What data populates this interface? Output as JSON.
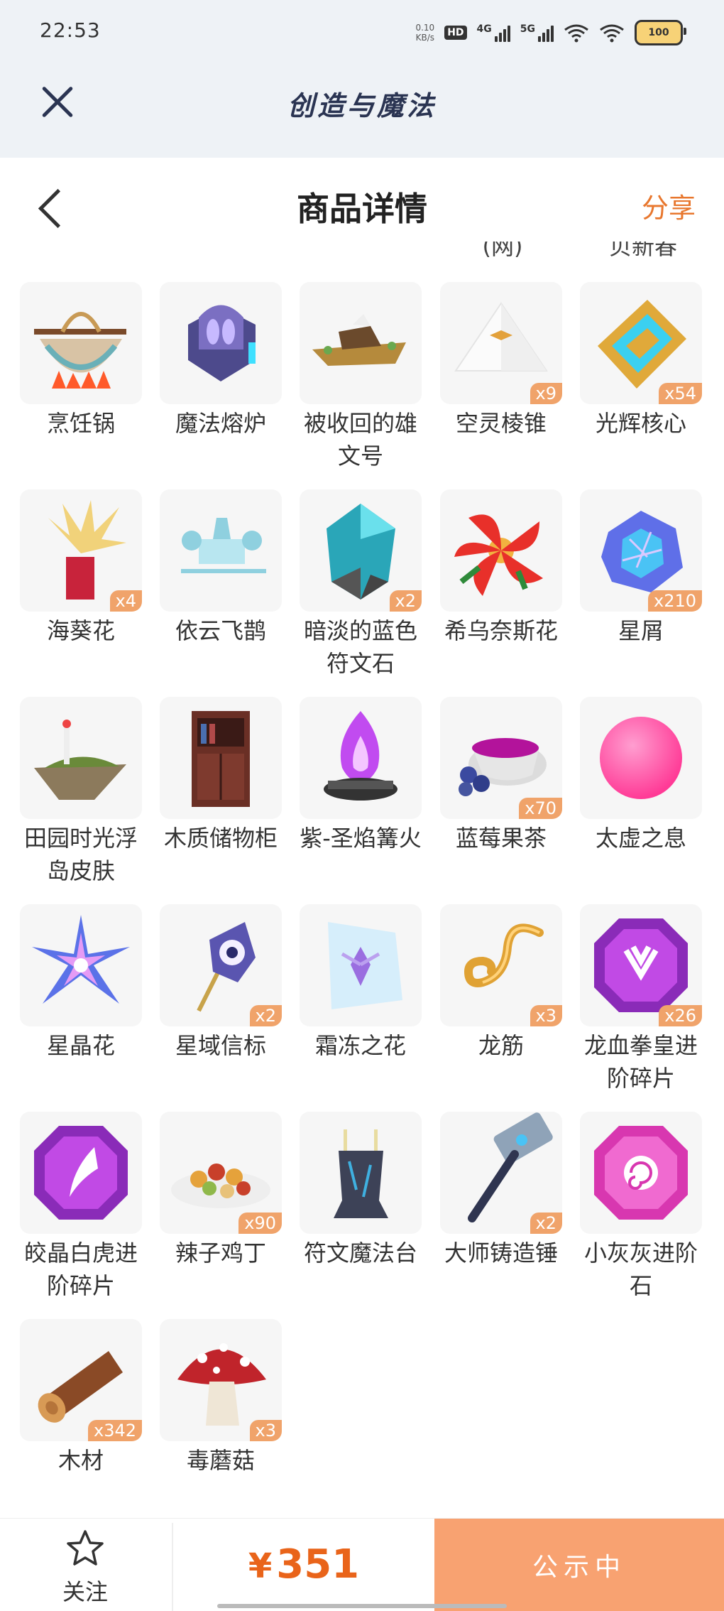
{
  "status_bar": {
    "time": "22:53",
    "net_speed": "0.10",
    "net_unit": "KB/s",
    "hd": "HD",
    "sig1": "4G",
    "sig2": "5G",
    "battery": "100"
  },
  "app": {
    "title": "创造与魔法"
  },
  "header": {
    "title": "商品详情",
    "share": "分享"
  },
  "cut_off_labels": [
    "(网)",
    "贝新春"
  ],
  "items": [
    {
      "name": "烹饪锅",
      "count": "",
      "icon": "cooking-pot-icon"
    },
    {
      "name": "魔法熔炉",
      "count": "",
      "icon": "magic-furnace-icon"
    },
    {
      "name": "被收回的雄文号",
      "count": "",
      "icon": "ship-icon"
    },
    {
      "name": "空灵棱锥",
      "count": "x9",
      "icon": "pyramid-icon"
    },
    {
      "name": "光辉核心",
      "count": "x54",
      "icon": "radiant-core-icon"
    },
    {
      "name": "海葵花",
      "count": "x4",
      "icon": "anemone-flower-icon"
    },
    {
      "name": "依云飞鹊",
      "count": "",
      "icon": "flying-mount-icon"
    },
    {
      "name": "暗淡的蓝色符文石",
      "count": "x2",
      "icon": "blue-rune-stone-icon"
    },
    {
      "name": "希乌奈斯花",
      "count": "",
      "icon": "red-flower-icon"
    },
    {
      "name": "星屑",
      "count": "x210",
      "icon": "stardust-icon"
    },
    {
      "name": "田园时光浮岛皮肤",
      "count": "",
      "icon": "floating-island-icon"
    },
    {
      "name": "木质储物柜",
      "count": "",
      "icon": "wooden-cabinet-icon"
    },
    {
      "name": "紫-圣焰篝火",
      "count": "",
      "icon": "purple-bonfire-icon"
    },
    {
      "name": "蓝莓果茶",
      "count": "x70",
      "icon": "blueberry-tea-icon"
    },
    {
      "name": "太虚之息",
      "count": "",
      "icon": "pink-orb-icon"
    },
    {
      "name": "星晶花",
      "count": "",
      "icon": "star-crystal-flower-icon"
    },
    {
      "name": "星域信标",
      "count": "x2",
      "icon": "star-beacon-icon"
    },
    {
      "name": "霜冻之花",
      "count": "",
      "icon": "frost-flower-icon"
    },
    {
      "name": "龙筋",
      "count": "x3",
      "icon": "dragon-sinew-icon"
    },
    {
      "name": "龙血拳皇进阶碎片",
      "count": "x26",
      "icon": "purple-gem-bull-icon"
    },
    {
      "name": "皎晶白虎进阶碎片",
      "count": "",
      "icon": "purple-gem-claw-icon"
    },
    {
      "name": "辣子鸡丁",
      "count": "x90",
      "icon": "spicy-chicken-icon"
    },
    {
      "name": "符文魔法台",
      "count": "",
      "icon": "rune-altar-icon"
    },
    {
      "name": "大师铸造锤",
      "count": "x2",
      "icon": "forge-hammer-icon"
    },
    {
      "name": "小灰灰进阶石",
      "count": "",
      "icon": "pink-gem-swirl-icon"
    },
    {
      "name": "木材",
      "count": "x342",
      "icon": "wood-log-icon"
    },
    {
      "name": "毒蘑菇",
      "count": "x3",
      "icon": "poison-mushroom-icon"
    }
  ],
  "bottom": {
    "follow": "关注",
    "currency": "¥",
    "price": "351",
    "status": "公示中"
  },
  "colors": {
    "accent": "#e8772e",
    "price": "#e9641a",
    "status_button": "#f8a271",
    "badge": "#f0a36a"
  }
}
